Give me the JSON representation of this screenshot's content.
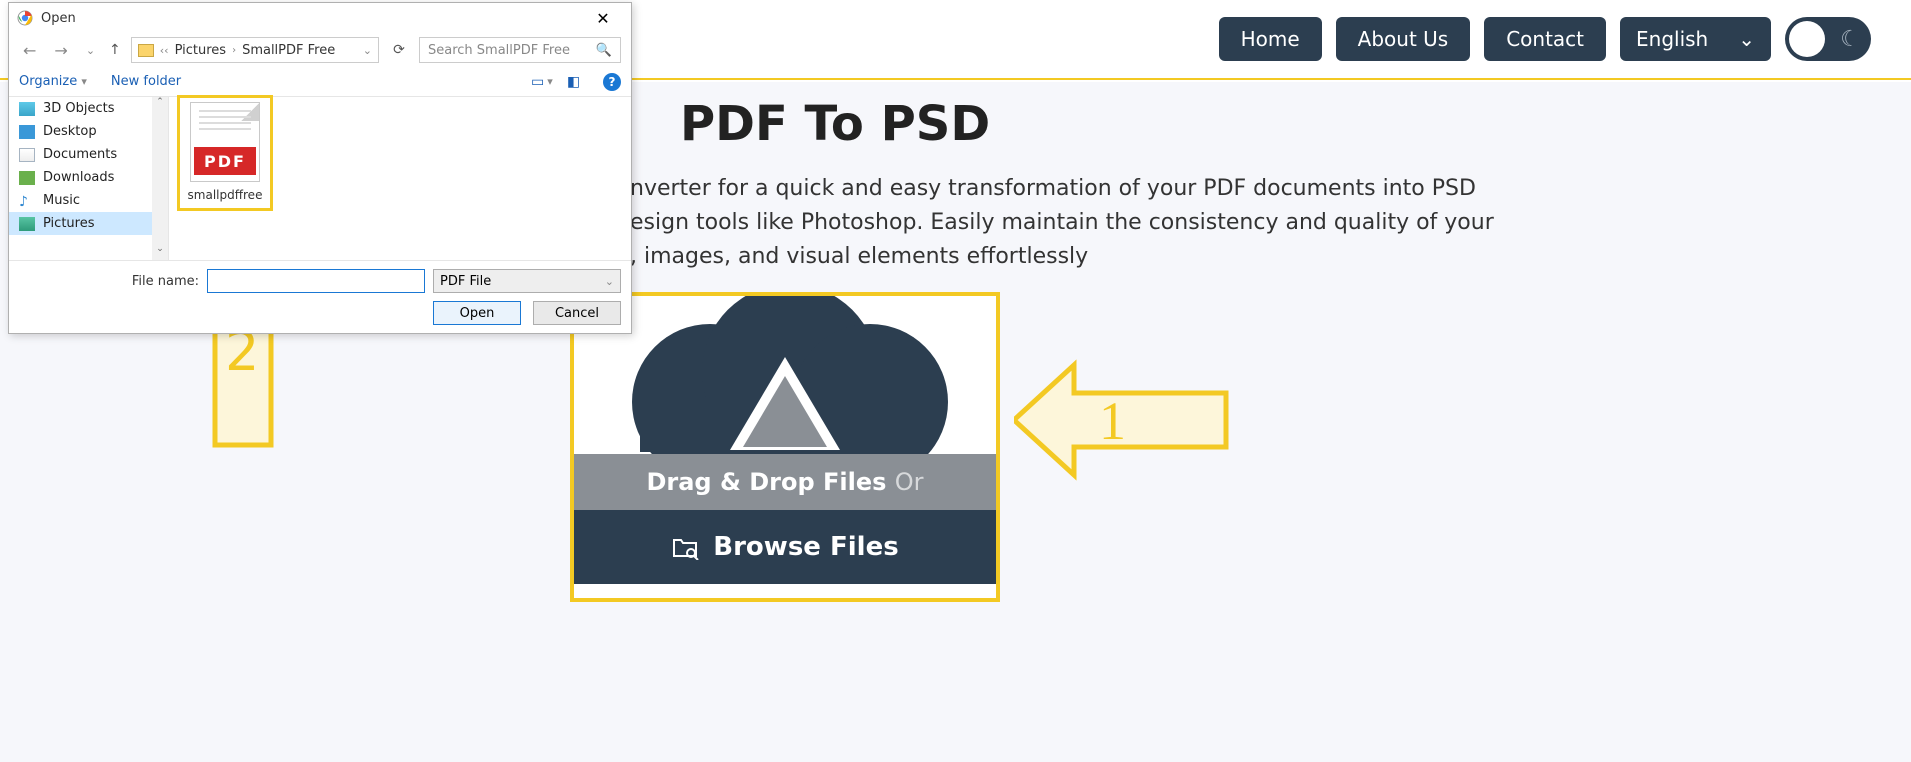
{
  "nav": {
    "home": "Home",
    "about": "About Us",
    "contact": "Contact",
    "lang": "English"
  },
  "page": {
    "title": "PDF To PSD",
    "desc_prefix": "nverter for a quick and easy transformation of your PDF documents into PSD",
    "desc_line2_prefix": "esign tools like Photoshop. Easily maintain the consistency and quality of your",
    "desc_line3_prefix": ", images, and visual elements effortlessly"
  },
  "upload": {
    "drag": "Drag & Drop Files",
    "or": "Or",
    "browse": "Browse Files"
  },
  "annot": {
    "one": "1",
    "two": "2"
  },
  "dialog": {
    "title": "Open",
    "breadcrumb": {
      "p1": "Pictures",
      "p2": "SmallPDF Free"
    },
    "search_placeholder": "Search SmallPDF Free",
    "organize": "Organize",
    "newfolder": "New folder",
    "tree": {
      "threeD": "3D Objects",
      "desktop": "Desktop",
      "documents": "Documents",
      "downloads": "Downloads",
      "music": "Music",
      "pictures": "Pictures"
    },
    "file": {
      "band": "PDF",
      "name": "smallpdffree"
    },
    "fn_label": "File name:",
    "filter": "PDF File",
    "open": "Open",
    "cancel": "Cancel"
  }
}
